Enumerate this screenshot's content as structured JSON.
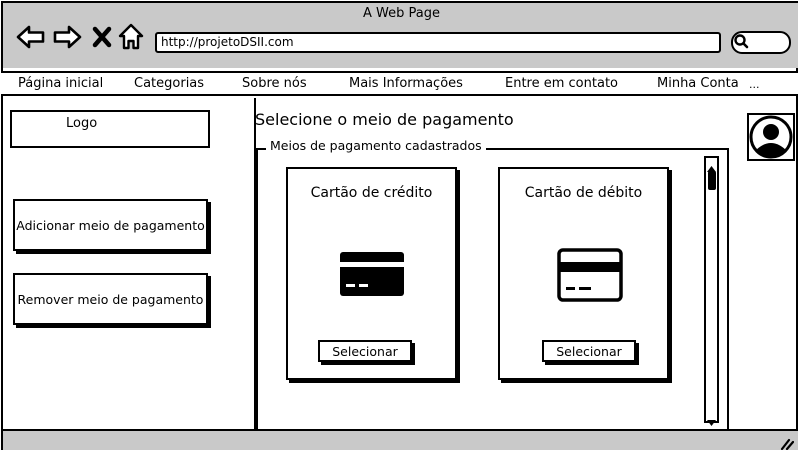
{
  "window": {
    "title": "A Web Page",
    "url": "http://projetoDSII.com"
  },
  "menu": {
    "items": [
      {
        "label": "Página inicial"
      },
      {
        "label": "Categorias"
      },
      {
        "label": "Sobre nós"
      },
      {
        "label": "Mais Informações"
      },
      {
        "label": "Entre em contato"
      },
      {
        "label": "Minha Conta"
      },
      {
        "label": "..."
      }
    ]
  },
  "sidebar": {
    "logo": "Logo",
    "add_button": "Adicionar meio de pagamento",
    "remove_button": "Remover meio de pagamento"
  },
  "main": {
    "title": "Selecione o meio de pagamento",
    "group_label": "Meios de pagamento cadastrados",
    "cards": [
      {
        "title": "Cartão de crédito",
        "button": "Selecionar",
        "icon": "credit-card-icon"
      },
      {
        "title": "Cartão de débito",
        "button": "Selecionar",
        "icon": "debit-card-icon"
      }
    ]
  },
  "icons": {
    "back": "back-arrow-icon",
    "forward": "forward-arrow-icon",
    "close": "close-icon",
    "home": "home-icon",
    "search": "search-icon",
    "avatar": "user-avatar-icon",
    "resize": "resize-grip-icon"
  }
}
